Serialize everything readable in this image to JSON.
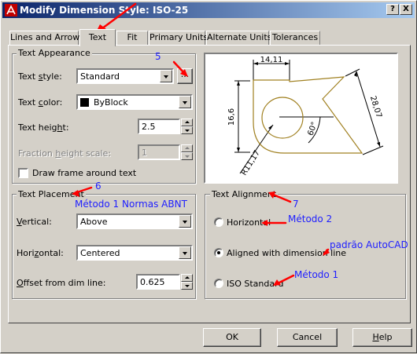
{
  "window": {
    "title": "Modify Dimension Style: ISO-25",
    "help_btn": "?",
    "close_btn": "X"
  },
  "tabs": [
    "Lines and Arrows",
    "Text",
    "Fit",
    "Primary Units",
    "Alternate Units",
    "Tolerances"
  ],
  "active_tab": "Text",
  "text_appearance": {
    "title": "Text Appearance",
    "style_label": "Text style:",
    "style_value": "Standard",
    "style_btn": "...",
    "color_label": "Text color:",
    "color_value": "ByBlock",
    "color_swatch": "#000000",
    "height_label": "Text height:",
    "height_value": "2.5",
    "fraction_label": "Fraction height scale:",
    "fraction_value": "1",
    "frame_label": "Draw frame around text",
    "frame_checked": false
  },
  "text_placement": {
    "title": "Text Placement",
    "vertical_label": "Vertical:",
    "vertical_value": "Above",
    "horizontal_label": "Horizontal:",
    "horizontal_value": "Centered",
    "offset_label": "Offset from dim line:",
    "offset_value": "0.625"
  },
  "text_alignment": {
    "title": "Text Alignment",
    "options": [
      "Horizontal",
      "Aligned with dimension line",
      "ISO Standard"
    ],
    "selected": "Aligned with dimension line"
  },
  "preview": {
    "dim_top": "14,11",
    "dim_left": "16,6",
    "dim_right": "28,07",
    "dim_angle": "60°",
    "dim_radius": "R11,17",
    "line_color": "#a08020"
  },
  "annotations": {
    "a5": "5",
    "a6": "6",
    "a7": "7",
    "metodo1_abnt": "Método 1 Normas ABNT",
    "metodo2": "Método 2",
    "padrao": "padrão AutoCAD",
    "metodo1": "Método 1",
    "color": "#2020ff",
    "arrow_color": "#ff0000"
  },
  "buttons": {
    "ok": "OK",
    "cancel": "Cancel",
    "help": "Help"
  }
}
